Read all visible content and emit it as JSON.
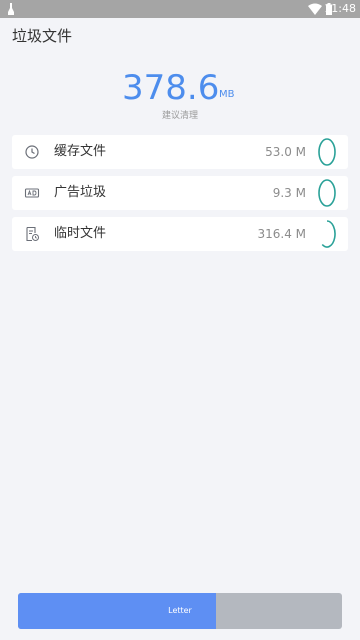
{
  "status_bar": {
    "time": "11:48",
    "icons": [
      "cleaner-icon",
      "wifi-icon",
      "battery-icon"
    ]
  },
  "app_bar": {
    "title": "垃圾文件"
  },
  "summary": {
    "amount": "378.6",
    "unit": "MB",
    "hint": "建议清理"
  },
  "items": [
    {
      "label": "缓存文件",
      "size": "53.0 M",
      "icon": "clock-icon",
      "progress": 1.0
    },
    {
      "label": "广告垃圾",
      "size": "9.3 M",
      "icon": "ad-icon",
      "progress": 1.0
    },
    {
      "label": "临时文件",
      "size": "316.4 M",
      "icon": "temp-file-icon",
      "progress": 0.6
    }
  ],
  "action": {
    "label": "Letter",
    "progress": 0.61
  },
  "colors": {
    "accent": "#4d8ded",
    "progress_ring": "#2aa198",
    "button_fill": "#5e8ff3",
    "button_track": "#b4b8bf",
    "status_bar": "#a5a5a5"
  }
}
